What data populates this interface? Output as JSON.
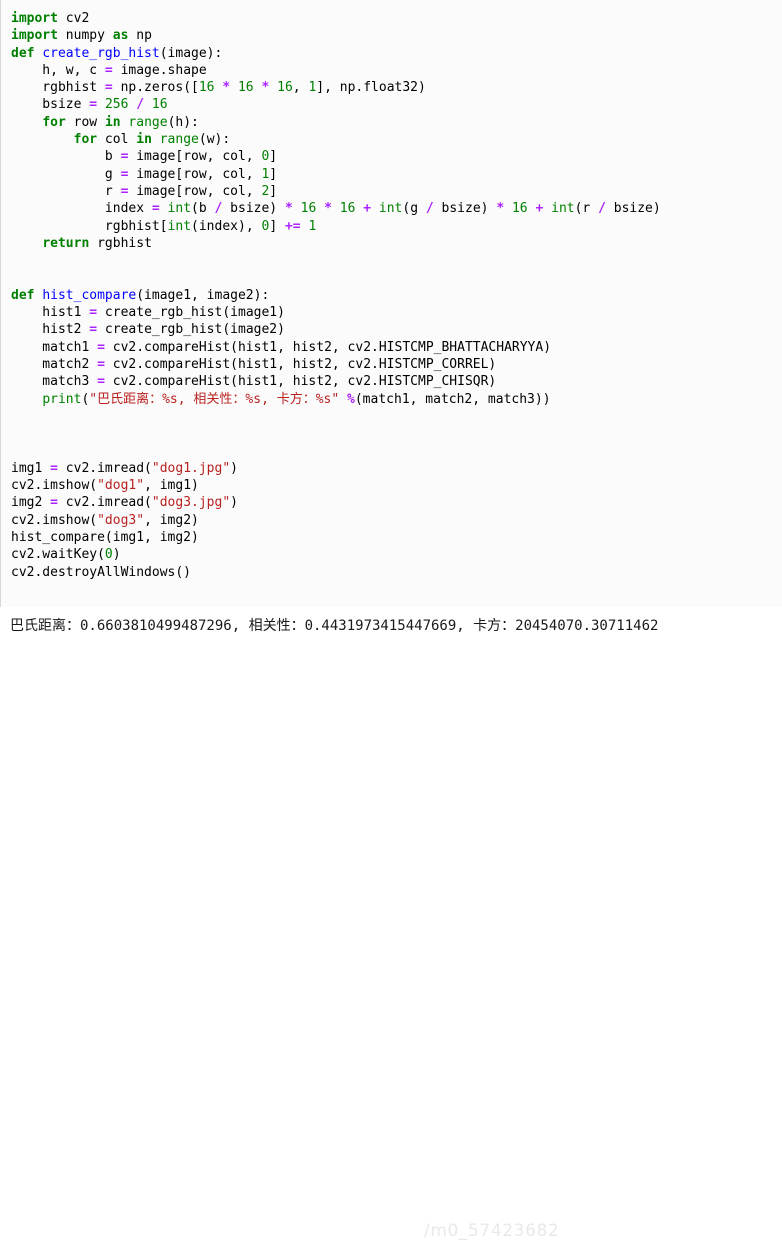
{
  "editor": {
    "language": "python",
    "background_color": "#fbfbfb",
    "gutter_border_color": "#d6d6d6",
    "theme_colors": {
      "keyword": "#008000",
      "function_name": "#0000ff",
      "builtin": "#008000",
      "number": "#008000",
      "operator": "#aa22ff",
      "string": "#ba2121",
      "plain": "#000000"
    },
    "lines": [
      {
        "id": "line-1",
        "tokens": [
          {
            "t": "import",
            "c": "k"
          },
          {
            "t": " cv2",
            "c": "n"
          }
        ]
      },
      {
        "id": "line-2",
        "tokens": [
          {
            "t": "import",
            "c": "k"
          },
          {
            "t": " numpy ",
            "c": "n"
          },
          {
            "t": "as",
            "c": "k"
          },
          {
            "t": " np",
            "c": "n"
          }
        ]
      },
      {
        "id": "line-3",
        "tokens": [
          {
            "t": "def",
            "c": "k"
          },
          {
            "t": " ",
            "c": "n"
          },
          {
            "t": "create_rgb_hist",
            "c": "nf"
          },
          {
            "t": "(image):",
            "c": "n"
          }
        ]
      },
      {
        "id": "line-4",
        "tokens": [
          {
            "t": "    h, w, c ",
            "c": "n"
          },
          {
            "t": "=",
            "c": "o"
          },
          {
            "t": " image.shape",
            "c": "n"
          }
        ]
      },
      {
        "id": "line-5",
        "tokens": [
          {
            "t": "    rgbhist ",
            "c": "n"
          },
          {
            "t": "=",
            "c": "o"
          },
          {
            "t": " np.zeros([",
            "c": "n"
          },
          {
            "t": "16",
            "c": "mi"
          },
          {
            "t": " ",
            "c": "n"
          },
          {
            "t": "*",
            "c": "o"
          },
          {
            "t": " ",
            "c": "n"
          },
          {
            "t": "16",
            "c": "mi"
          },
          {
            "t": " ",
            "c": "n"
          },
          {
            "t": "*",
            "c": "o"
          },
          {
            "t": " ",
            "c": "n"
          },
          {
            "t": "16",
            "c": "mi"
          },
          {
            "t": ", ",
            "c": "n"
          },
          {
            "t": "1",
            "c": "mi"
          },
          {
            "t": "], np.float32)",
            "c": "n"
          }
        ]
      },
      {
        "id": "line-6",
        "tokens": [
          {
            "t": "    bsize ",
            "c": "n"
          },
          {
            "t": "=",
            "c": "o"
          },
          {
            "t": " ",
            "c": "n"
          },
          {
            "t": "256",
            "c": "mi"
          },
          {
            "t": " ",
            "c": "n"
          },
          {
            "t": "/",
            "c": "o"
          },
          {
            "t": " ",
            "c": "n"
          },
          {
            "t": "16",
            "c": "mi"
          }
        ]
      },
      {
        "id": "line-7",
        "tokens": [
          {
            "t": "    ",
            "c": "n"
          },
          {
            "t": "for",
            "c": "k"
          },
          {
            "t": " row ",
            "c": "n"
          },
          {
            "t": "in",
            "c": "k"
          },
          {
            "t": " ",
            "c": "n"
          },
          {
            "t": "range",
            "c": "nb"
          },
          {
            "t": "(h):",
            "c": "n"
          }
        ]
      },
      {
        "id": "line-8",
        "tokens": [
          {
            "t": "        ",
            "c": "n"
          },
          {
            "t": "for",
            "c": "k"
          },
          {
            "t": " col ",
            "c": "n"
          },
          {
            "t": "in",
            "c": "k"
          },
          {
            "t": " ",
            "c": "n"
          },
          {
            "t": "range",
            "c": "nb"
          },
          {
            "t": "(w):",
            "c": "n"
          }
        ]
      },
      {
        "id": "line-9",
        "tokens": [
          {
            "t": "            b ",
            "c": "n"
          },
          {
            "t": "=",
            "c": "o"
          },
          {
            "t": " image[row, col, ",
            "c": "n"
          },
          {
            "t": "0",
            "c": "mi"
          },
          {
            "t": "]",
            "c": "n"
          }
        ]
      },
      {
        "id": "line-10",
        "tokens": [
          {
            "t": "            g ",
            "c": "n"
          },
          {
            "t": "=",
            "c": "o"
          },
          {
            "t": " image[row, col, ",
            "c": "n"
          },
          {
            "t": "1",
            "c": "mi"
          },
          {
            "t": "]",
            "c": "n"
          }
        ]
      },
      {
        "id": "line-11",
        "tokens": [
          {
            "t": "            r ",
            "c": "n"
          },
          {
            "t": "=",
            "c": "o"
          },
          {
            "t": " image[row, col, ",
            "c": "n"
          },
          {
            "t": "2",
            "c": "mi"
          },
          {
            "t": "]",
            "c": "n"
          }
        ]
      },
      {
        "id": "line-12",
        "tokens": [
          {
            "t": "            index ",
            "c": "n"
          },
          {
            "t": "=",
            "c": "o"
          },
          {
            "t": " ",
            "c": "n"
          },
          {
            "t": "int",
            "c": "nb"
          },
          {
            "t": "(b ",
            "c": "n"
          },
          {
            "t": "/",
            "c": "o"
          },
          {
            "t": " bsize) ",
            "c": "n"
          },
          {
            "t": "*",
            "c": "o"
          },
          {
            "t": " ",
            "c": "n"
          },
          {
            "t": "16",
            "c": "mi"
          },
          {
            "t": " ",
            "c": "n"
          },
          {
            "t": "*",
            "c": "o"
          },
          {
            "t": " ",
            "c": "n"
          },
          {
            "t": "16",
            "c": "mi"
          },
          {
            "t": " ",
            "c": "n"
          },
          {
            "t": "+",
            "c": "o"
          },
          {
            "t": " ",
            "c": "n"
          },
          {
            "t": "int",
            "c": "nb"
          },
          {
            "t": "(g ",
            "c": "n"
          },
          {
            "t": "/",
            "c": "o"
          },
          {
            "t": " bsize) ",
            "c": "n"
          },
          {
            "t": "*",
            "c": "o"
          },
          {
            "t": " ",
            "c": "n"
          },
          {
            "t": "16",
            "c": "mi"
          },
          {
            "t": " ",
            "c": "n"
          },
          {
            "t": "+",
            "c": "o"
          },
          {
            "t": " ",
            "c": "n"
          },
          {
            "t": "int",
            "c": "nb"
          },
          {
            "t": "(r ",
            "c": "n"
          },
          {
            "t": "/",
            "c": "o"
          },
          {
            "t": " bsize)",
            "c": "n"
          }
        ]
      },
      {
        "id": "line-13",
        "tokens": [
          {
            "t": "            rgbhist[",
            "c": "n"
          },
          {
            "t": "int",
            "c": "nb"
          },
          {
            "t": "(index), ",
            "c": "n"
          },
          {
            "t": "0",
            "c": "mi"
          },
          {
            "t": "] ",
            "c": "n"
          },
          {
            "t": "+=",
            "c": "o"
          },
          {
            "t": " ",
            "c": "n"
          },
          {
            "t": "1",
            "c": "mi"
          }
        ]
      },
      {
        "id": "line-14",
        "tokens": [
          {
            "t": "    ",
            "c": "n"
          },
          {
            "t": "return",
            "c": "k"
          },
          {
            "t": " rgbhist",
            "c": "n"
          }
        ]
      },
      {
        "id": "line-15",
        "tokens": [
          {
            "t": "",
            "c": "n"
          }
        ]
      },
      {
        "id": "line-16",
        "tokens": [
          {
            "t": "",
            "c": "n"
          }
        ]
      },
      {
        "id": "line-17",
        "tokens": [
          {
            "t": "def",
            "c": "k"
          },
          {
            "t": " ",
            "c": "n"
          },
          {
            "t": "hist_compare",
            "c": "nf"
          },
          {
            "t": "(image1, image2):",
            "c": "n"
          }
        ]
      },
      {
        "id": "line-18",
        "tokens": [
          {
            "t": "    hist1 ",
            "c": "n"
          },
          {
            "t": "=",
            "c": "o"
          },
          {
            "t": " create_rgb_hist(image1)",
            "c": "n"
          }
        ]
      },
      {
        "id": "line-19",
        "tokens": [
          {
            "t": "    hist2 ",
            "c": "n"
          },
          {
            "t": "=",
            "c": "o"
          },
          {
            "t": " create_rgb_hist(image2)",
            "c": "n"
          }
        ]
      },
      {
        "id": "line-20",
        "tokens": [
          {
            "t": "    match1 ",
            "c": "n"
          },
          {
            "t": "=",
            "c": "o"
          },
          {
            "t": " cv2.compareHist(hist1, hist2, cv2.HISTCMP_BHATTACHARYYA)",
            "c": "n"
          }
        ]
      },
      {
        "id": "line-21",
        "tokens": [
          {
            "t": "    match2 ",
            "c": "n"
          },
          {
            "t": "=",
            "c": "o"
          },
          {
            "t": " cv2.compareHist(hist1, hist2, cv2.HISTCMP_CORREL)",
            "c": "n"
          }
        ]
      },
      {
        "id": "line-22",
        "tokens": [
          {
            "t": "    match3 ",
            "c": "n"
          },
          {
            "t": "=",
            "c": "o"
          },
          {
            "t": " cv2.compareHist(hist1, hist2, cv2.HISTCMP_CHISQR)",
            "c": "n"
          }
        ]
      },
      {
        "id": "line-23",
        "tokens": [
          {
            "t": "    ",
            "c": "n"
          },
          {
            "t": "print",
            "c": "nb"
          },
          {
            "t": "(",
            "c": "n"
          },
          {
            "t": "\"巴氏距离：%s, 相关性：%s, 卡方：%s\"",
            "c": "s"
          },
          {
            "t": " ",
            "c": "n"
          },
          {
            "t": "%",
            "c": "o"
          },
          {
            "t": "(match1, match2, match3))",
            "c": "n"
          }
        ]
      },
      {
        "id": "line-24",
        "tokens": [
          {
            "t": "",
            "c": "n"
          }
        ]
      },
      {
        "id": "line-25",
        "tokens": [
          {
            "t": "",
            "c": "n"
          }
        ]
      },
      {
        "id": "line-26",
        "tokens": [
          {
            "t": "",
            "c": "n"
          }
        ]
      },
      {
        "id": "line-27",
        "tokens": [
          {
            "t": "img1 ",
            "c": "n"
          },
          {
            "t": "=",
            "c": "o"
          },
          {
            "t": " cv2.imread(",
            "c": "n"
          },
          {
            "t": "\"dog1.jpg\"",
            "c": "s"
          },
          {
            "t": ")",
            "c": "n"
          }
        ]
      },
      {
        "id": "line-28",
        "tokens": [
          {
            "t": "cv2.imshow(",
            "c": "n"
          },
          {
            "t": "\"dog1\"",
            "c": "s"
          },
          {
            "t": ", img1)",
            "c": "n"
          }
        ]
      },
      {
        "id": "line-29",
        "tokens": [
          {
            "t": "img2 ",
            "c": "n"
          },
          {
            "t": "=",
            "c": "o"
          },
          {
            "t": " cv2.imread(",
            "c": "n"
          },
          {
            "t": "\"dog3.jpg\"",
            "c": "s"
          },
          {
            "t": ")",
            "c": "n"
          }
        ]
      },
      {
        "id": "line-30",
        "tokens": [
          {
            "t": "cv2.imshow(",
            "c": "n"
          },
          {
            "t": "\"dog3\"",
            "c": "s"
          },
          {
            "t": ", img2)",
            "c": "n"
          }
        ]
      },
      {
        "id": "line-31",
        "tokens": [
          {
            "t": "hist_compare(img1, img2)",
            "c": "n"
          }
        ]
      },
      {
        "id": "line-32",
        "tokens": [
          {
            "t": "cv2.waitKey(",
            "c": "n"
          },
          {
            "t": "0",
            "c": "mi"
          },
          {
            "t": ")",
            "c": "n"
          }
        ]
      },
      {
        "id": "line-33",
        "tokens": [
          {
            "t": "cv2.destroyAllWindows()",
            "c": "n"
          }
        ]
      }
    ]
  },
  "output": {
    "text": "巴氏距离：0.6603810499487296, 相关性：0.4431973415447669, 卡方：20454070.30711462",
    "bhattacharyya_label": "巴氏距离",
    "bhattacharyya_value": "0.6603810499487296",
    "correlation_label": "相关性",
    "correlation_value": "0.4431973415447669",
    "chisqr_label": "卡方",
    "chisqr_value": "20454070.30711462"
  },
  "watermark": {
    "text": "https://blog.csdn.net/m0_57423682",
    "visible_text": "/m0_57423682",
    "color": "#e9e9e9"
  }
}
